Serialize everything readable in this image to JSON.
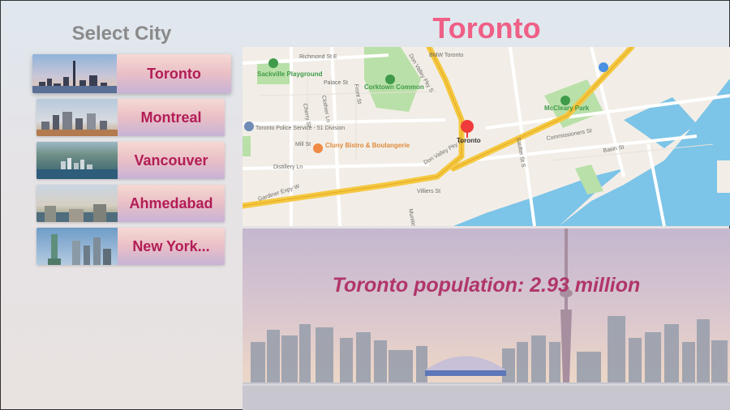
{
  "sidebar": {
    "title": "Select City",
    "cities": [
      {
        "label": "Toronto",
        "selected": true
      },
      {
        "label": "Montreal",
        "selected": false
      },
      {
        "label": "Vancouver",
        "selected": false
      },
      {
        "label": "Ahmedabad",
        "selected": false
      },
      {
        "label": "New York..."
      }
    ]
  },
  "header": {
    "title": "Toronto"
  },
  "map": {
    "labels": {
      "richmond": "Richmond St E",
      "valley1": "Don Valley Pky S",
      "bmw": "BMW Toronto",
      "sackville": "Sackville Playground",
      "corktown": "Corktown Common",
      "palace": "Palace St",
      "cherry": "Cherry St",
      "clothier": "Clothier Ln",
      "mcgee": "Front St",
      "police": "Toronto Police Service - 51 Division",
      "mill": "Mill St",
      "cluny": "Cluny Bistro & Boulangerie",
      "distillery": "Distillery Ln",
      "gardiner": "Gardiner Expy W",
      "dvp": "Don Valley Pky N",
      "villiers": "Villiers St",
      "munition": "Munition St",
      "pin_label": "Toronto",
      "mccleary": "McCleary Park",
      "saulter": "Saulter St S",
      "commissioners": "Commissioners St",
      "basin": "Basin St"
    },
    "colors": {
      "highway": "#f5c842",
      "water": "#7cc4e8",
      "park": "#b9e0a8",
      "pin": "#ef3b3b",
      "park_label": "#3f9a4a",
      "food_label": "#e08a3c"
    }
  },
  "photo": {
    "caption": "Toronto population: 2.93 million"
  }
}
